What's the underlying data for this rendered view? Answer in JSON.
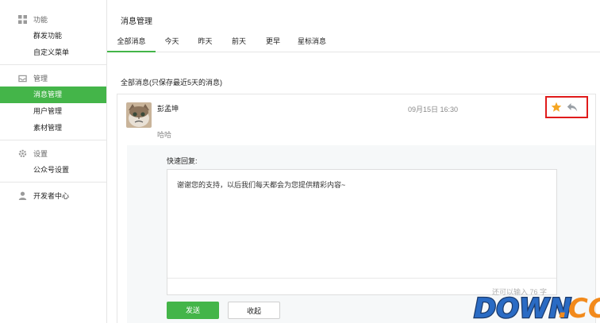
{
  "sidebar": {
    "groups": [
      {
        "title": "功能",
        "icon": "grid-icon",
        "items": [
          {
            "label": "群发功能"
          },
          {
            "label": "自定义菜单"
          }
        ]
      },
      {
        "title": "管理",
        "icon": "inbox-icon",
        "items": [
          {
            "label": "消息管理",
            "active": true
          },
          {
            "label": "用户管理"
          },
          {
            "label": "素材管理"
          }
        ]
      },
      {
        "title": "设置",
        "icon": "gear-icon",
        "items": [
          {
            "label": "公众号设置"
          }
        ]
      },
      {
        "title": "开发者中心",
        "icon": "user-icon",
        "items": []
      }
    ]
  },
  "main": {
    "title": "消息管理",
    "tabs": [
      {
        "label": "全部消息",
        "active": true
      },
      {
        "label": "今天"
      },
      {
        "label": "昨天"
      },
      {
        "label": "前天"
      },
      {
        "label": "更早"
      },
      {
        "label": "星标消息"
      }
    ],
    "section_label": "全部消息(只保存最近5天的消息)",
    "message": {
      "nickname": "彭孟坤",
      "text": "哈哈",
      "time": "09月15日 16:30",
      "starred": true
    },
    "reply": {
      "label": "快速回复:",
      "value": "谢谢您的支持，以后我们每天都会为您提供精彩内容~",
      "counter": "还可以输入 76 字",
      "send_label": "发送",
      "cancel_label": "收起"
    }
  },
  "watermark": {
    "text": "DOWN.CC"
  },
  "colors": {
    "accent": "#44b549",
    "highlight_box": "#e01b1b",
    "star": "#f5a623"
  }
}
